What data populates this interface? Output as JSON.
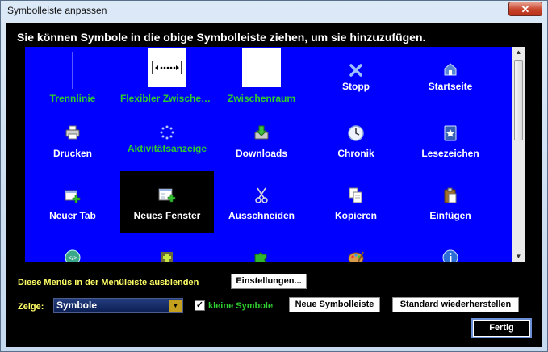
{
  "window": {
    "title": "Symbolleiste anpassen",
    "close_glyph": "✕"
  },
  "instruction": "Sie können Symbole in die obige Symbolleiste ziehen, um sie hinzuzufügen.",
  "palette": {
    "items": [
      {
        "label": "Trennlinie",
        "icon": "separator-icon",
        "color": "green"
      },
      {
        "label": "Flexibler Zwischenraum",
        "icon": "flexible-space-icon",
        "color": "green"
      },
      {
        "label": "Zwischenraum",
        "icon": "space-icon",
        "color": "green"
      },
      {
        "label": "Stopp",
        "icon": "stop-icon",
        "color": "white"
      },
      {
        "label": "Startseite",
        "icon": "home-icon",
        "color": "white"
      },
      {
        "label": "Drucken",
        "icon": "print-icon",
        "color": "white"
      },
      {
        "label": "Aktivitätsanzeige",
        "icon": "throbber-icon",
        "color": "green"
      },
      {
        "label": "Downloads",
        "icon": "downloads-icon",
        "color": "white"
      },
      {
        "label": "Chronik",
        "icon": "history-icon",
        "color": "white"
      },
      {
        "label": "Lesezeichen",
        "icon": "bookmarks-icon",
        "color": "white"
      },
      {
        "label": "Neuer Tab",
        "icon": "new-tab-icon",
        "color": "white"
      },
      {
        "label": "Neues Fenster",
        "icon": "new-window-icon",
        "color": "white",
        "selected": true
      },
      {
        "label": "Ausschneiden",
        "icon": "cut-icon",
        "color": "white"
      },
      {
        "label": "Kopieren",
        "icon": "copy-icon",
        "color": "white"
      },
      {
        "label": "Einfügen",
        "icon": "paste-icon",
        "color": "white"
      },
      {
        "label": "",
        "icon": "developer-icon"
      },
      {
        "label": "",
        "icon": "addons-icon"
      },
      {
        "label": "",
        "icon": "puzzle-icon"
      },
      {
        "label": "",
        "icon": "paint-icon"
      },
      {
        "label": "",
        "icon": "info-icon"
      }
    ]
  },
  "menus_hide_label": "Diese Menüs in der Menüleiste ausblenden",
  "settings_button": "Einstellungen...",
  "show": {
    "label": "Zeige:",
    "value": "Symbole",
    "dropdown_glyph": "▼"
  },
  "small_icons": {
    "label": "kleine Symbole",
    "checked_glyph": "✓"
  },
  "new_toolbar_button": "Neue Symbolleiste",
  "restore_default_button": "Standard wiederherstellen",
  "done_button": "Fertig",
  "scrollbar": {
    "up_glyph": "▲",
    "down_glyph": "▼"
  },
  "colors": {
    "palette_bg": "#0000ff",
    "selected_bg": "#000000",
    "label_green": "#2ecc2e",
    "label_white": "#ffffff",
    "hint_yellow": "#ffff66"
  }
}
